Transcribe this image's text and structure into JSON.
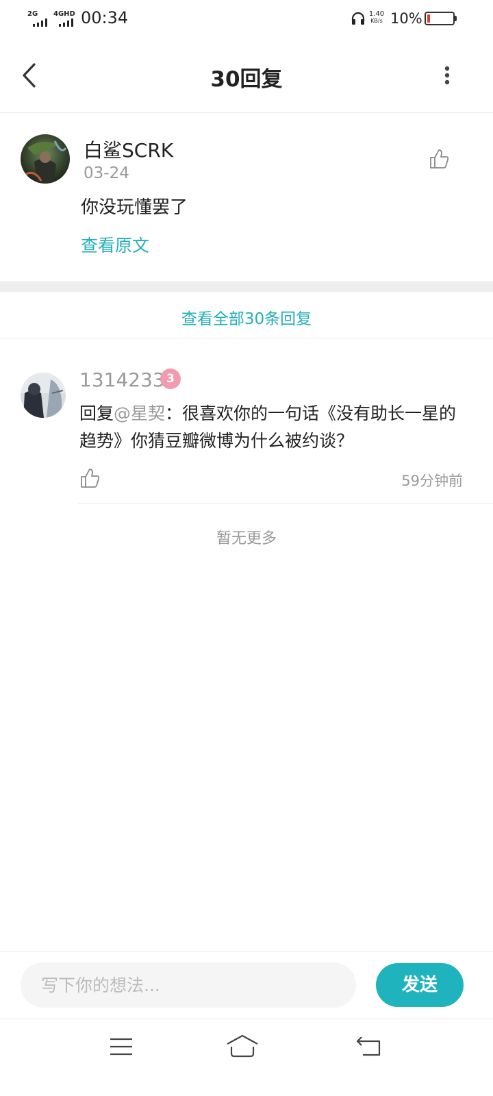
{
  "status_bar": {
    "signal1": "2G",
    "signal2": "4GHD",
    "time": "00:34",
    "net_speed_value": "1.40",
    "net_speed_unit": "KB/s",
    "battery_percent": "10%",
    "battery_level": 0.1,
    "battery_color": "#e53935"
  },
  "header": {
    "title": "30回复"
  },
  "original_comment": {
    "username": "白鲨SCRK",
    "date": "03-24",
    "content": "你没玩懂罢了",
    "view_original_label": "查看原文"
  },
  "view_all_label": "查看全部30条回复",
  "replies": [
    {
      "username": "1314233",
      "level_badge": "3",
      "reply_prefix": "回复",
      "mention": "@星契",
      "text": "：很喜欢你的一句话《没有助长一星的趋势》你猜豆瓣微博为什么被约谈？",
      "time": "59分钟前"
    }
  ],
  "no_more_label": "暂无更多",
  "composer": {
    "placeholder": "写下你的想法...",
    "send_label": "发送"
  },
  "colors": {
    "accent": "#1fafb8",
    "send_button": "#1fb3be",
    "muted_text": "#999999"
  }
}
